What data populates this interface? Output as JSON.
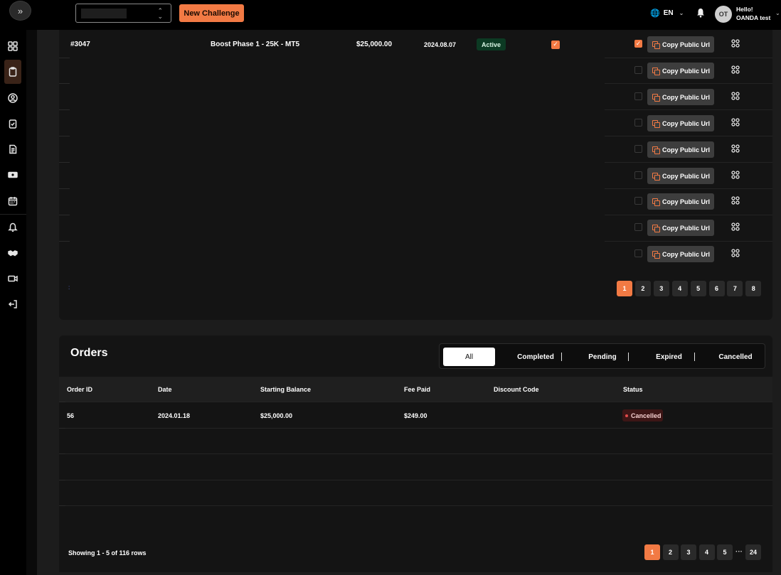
{
  "header": {
    "new_challenge_label": "New Challenge",
    "language": "EN",
    "avatar_initials": "OT",
    "greeting": "Hello!",
    "user_name": "OANDA test"
  },
  "sidebar": {
    "icons": [
      "dashboard-icon",
      "clipboard-icon",
      "user-circle-icon",
      "checklist-icon",
      "document-icon",
      "money-icon",
      "calendar-icon",
      "bell-icon",
      "handshake-icon",
      "video-icon",
      "logout-icon"
    ],
    "active_index": 1
  },
  "accounts": {
    "row": {
      "id": "#3047",
      "name": "Boost Phase 1 - 25K - MT5",
      "balance": "$25,000.00",
      "date": "2024.08.07",
      "status": "Active"
    },
    "copy_label": "Copy Public Url",
    "row_count": 9,
    "checked_row": 0,
    "stray_char": ":",
    "pagination": [
      "1",
      "2",
      "3",
      "4",
      "5",
      "6",
      "7",
      "8"
    ],
    "current_page": "1"
  },
  "orders": {
    "title": "Orders",
    "tabs": [
      "All",
      "Completed",
      "Pending",
      "Expired",
      "Cancelled"
    ],
    "active_tab": "All",
    "columns": [
      "Order ID",
      "Date",
      "Starting Balance",
      "Fee Paid",
      "Discount Code",
      "Status"
    ],
    "rows": [
      {
        "order_id": "56",
        "date": "2024.01.18",
        "starting_balance": "$25,000.00",
        "fee_paid": "$249.00",
        "discount_code": "",
        "status": "Cancelled"
      }
    ],
    "showing": "Showing 1 - 5 of 116 rows",
    "pagination": [
      "1",
      "2",
      "3",
      "4",
      "5"
    ],
    "pagination_ellipsis": "···",
    "pagination_last": "24",
    "current_page": "1"
  },
  "colors": {
    "accent": "#f27a44",
    "active_badge": "#0c3a23",
    "cancelled_badge": "#3d1616"
  }
}
